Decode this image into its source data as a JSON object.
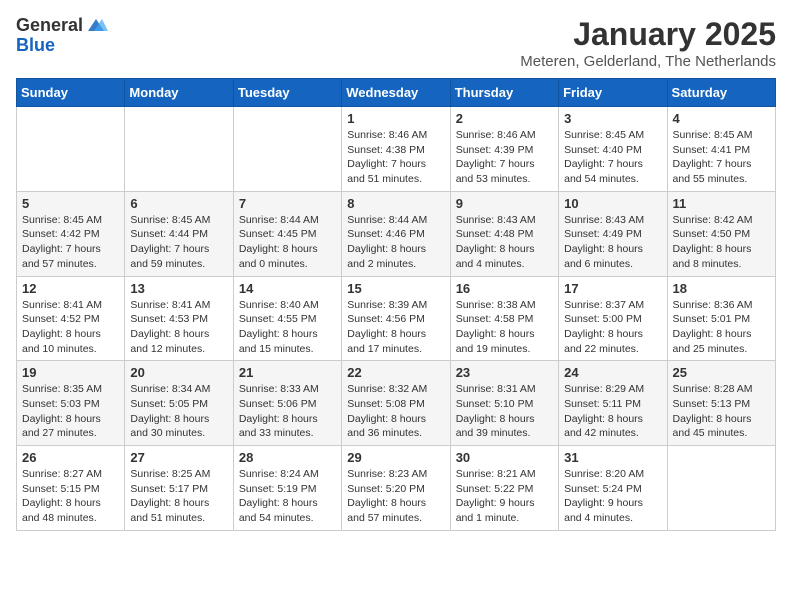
{
  "header": {
    "logo_general": "General",
    "logo_blue": "Blue",
    "month_title": "January 2025",
    "subtitle": "Meteren, Gelderland, The Netherlands"
  },
  "days_of_week": [
    "Sunday",
    "Monday",
    "Tuesday",
    "Wednesday",
    "Thursday",
    "Friday",
    "Saturday"
  ],
  "weeks": [
    [
      {
        "day": "",
        "info": ""
      },
      {
        "day": "",
        "info": ""
      },
      {
        "day": "",
        "info": ""
      },
      {
        "day": "1",
        "info": "Sunrise: 8:46 AM\nSunset: 4:38 PM\nDaylight: 7 hours\nand 51 minutes."
      },
      {
        "day": "2",
        "info": "Sunrise: 8:46 AM\nSunset: 4:39 PM\nDaylight: 7 hours\nand 53 minutes."
      },
      {
        "day": "3",
        "info": "Sunrise: 8:45 AM\nSunset: 4:40 PM\nDaylight: 7 hours\nand 54 minutes."
      },
      {
        "day": "4",
        "info": "Sunrise: 8:45 AM\nSunset: 4:41 PM\nDaylight: 7 hours\nand 55 minutes."
      }
    ],
    [
      {
        "day": "5",
        "info": "Sunrise: 8:45 AM\nSunset: 4:42 PM\nDaylight: 7 hours\nand 57 minutes."
      },
      {
        "day": "6",
        "info": "Sunrise: 8:45 AM\nSunset: 4:44 PM\nDaylight: 7 hours\nand 59 minutes."
      },
      {
        "day": "7",
        "info": "Sunrise: 8:44 AM\nSunset: 4:45 PM\nDaylight: 8 hours\nand 0 minutes."
      },
      {
        "day": "8",
        "info": "Sunrise: 8:44 AM\nSunset: 4:46 PM\nDaylight: 8 hours\nand 2 minutes."
      },
      {
        "day": "9",
        "info": "Sunrise: 8:43 AM\nSunset: 4:48 PM\nDaylight: 8 hours\nand 4 minutes."
      },
      {
        "day": "10",
        "info": "Sunrise: 8:43 AM\nSunset: 4:49 PM\nDaylight: 8 hours\nand 6 minutes."
      },
      {
        "day": "11",
        "info": "Sunrise: 8:42 AM\nSunset: 4:50 PM\nDaylight: 8 hours\nand 8 minutes."
      }
    ],
    [
      {
        "day": "12",
        "info": "Sunrise: 8:41 AM\nSunset: 4:52 PM\nDaylight: 8 hours\nand 10 minutes."
      },
      {
        "day": "13",
        "info": "Sunrise: 8:41 AM\nSunset: 4:53 PM\nDaylight: 8 hours\nand 12 minutes."
      },
      {
        "day": "14",
        "info": "Sunrise: 8:40 AM\nSunset: 4:55 PM\nDaylight: 8 hours\nand 15 minutes."
      },
      {
        "day": "15",
        "info": "Sunrise: 8:39 AM\nSunset: 4:56 PM\nDaylight: 8 hours\nand 17 minutes."
      },
      {
        "day": "16",
        "info": "Sunrise: 8:38 AM\nSunset: 4:58 PM\nDaylight: 8 hours\nand 19 minutes."
      },
      {
        "day": "17",
        "info": "Sunrise: 8:37 AM\nSunset: 5:00 PM\nDaylight: 8 hours\nand 22 minutes."
      },
      {
        "day": "18",
        "info": "Sunrise: 8:36 AM\nSunset: 5:01 PM\nDaylight: 8 hours\nand 25 minutes."
      }
    ],
    [
      {
        "day": "19",
        "info": "Sunrise: 8:35 AM\nSunset: 5:03 PM\nDaylight: 8 hours\nand 27 minutes."
      },
      {
        "day": "20",
        "info": "Sunrise: 8:34 AM\nSunset: 5:05 PM\nDaylight: 8 hours\nand 30 minutes."
      },
      {
        "day": "21",
        "info": "Sunrise: 8:33 AM\nSunset: 5:06 PM\nDaylight: 8 hours\nand 33 minutes."
      },
      {
        "day": "22",
        "info": "Sunrise: 8:32 AM\nSunset: 5:08 PM\nDaylight: 8 hours\nand 36 minutes."
      },
      {
        "day": "23",
        "info": "Sunrise: 8:31 AM\nSunset: 5:10 PM\nDaylight: 8 hours\nand 39 minutes."
      },
      {
        "day": "24",
        "info": "Sunrise: 8:29 AM\nSunset: 5:11 PM\nDaylight: 8 hours\nand 42 minutes."
      },
      {
        "day": "25",
        "info": "Sunrise: 8:28 AM\nSunset: 5:13 PM\nDaylight: 8 hours\nand 45 minutes."
      }
    ],
    [
      {
        "day": "26",
        "info": "Sunrise: 8:27 AM\nSunset: 5:15 PM\nDaylight: 8 hours\nand 48 minutes."
      },
      {
        "day": "27",
        "info": "Sunrise: 8:25 AM\nSunset: 5:17 PM\nDaylight: 8 hours\nand 51 minutes."
      },
      {
        "day": "28",
        "info": "Sunrise: 8:24 AM\nSunset: 5:19 PM\nDaylight: 8 hours\nand 54 minutes."
      },
      {
        "day": "29",
        "info": "Sunrise: 8:23 AM\nSunset: 5:20 PM\nDaylight: 8 hours\nand 57 minutes."
      },
      {
        "day": "30",
        "info": "Sunrise: 8:21 AM\nSunset: 5:22 PM\nDaylight: 9 hours\nand 1 minute."
      },
      {
        "day": "31",
        "info": "Sunrise: 8:20 AM\nSunset: 5:24 PM\nDaylight: 9 hours\nand 4 minutes."
      },
      {
        "day": "",
        "info": ""
      }
    ]
  ]
}
